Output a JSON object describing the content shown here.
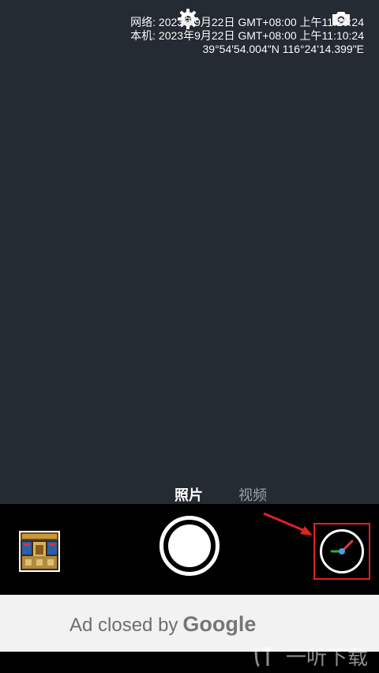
{
  "overlay": {
    "line1": "网络: 2023年9月22日 GMT+08:00 上午11:10:24",
    "line2": "本机: 2023年9月22日 GMT+08:00 上午11:10:24",
    "line3": "39°54'54.004\"N 116°24'14.399\"E"
  },
  "top_bar": {
    "settings_icon": "settings-gear-icon",
    "switch_camera_icon": "switch-camera-icon"
  },
  "modes": {
    "active": "照片",
    "inactive": "视频"
  },
  "controls": {
    "thumbnail_icon": "last-photo-thumbnail",
    "shutter_icon": "shutter-button",
    "timer_icon": "timer-clock-icon"
  },
  "ad": {
    "text": "Ad closed by",
    "brand": "Google"
  },
  "watermark": {
    "text": "一听下载"
  },
  "colors": {
    "viewfinder_bg": "#252b33",
    "highlight": "#e32121",
    "timer_hand_red": "#e53935",
    "timer_hand_green": "#2ea84a",
    "timer_center_blue": "#4a9fe8"
  }
}
